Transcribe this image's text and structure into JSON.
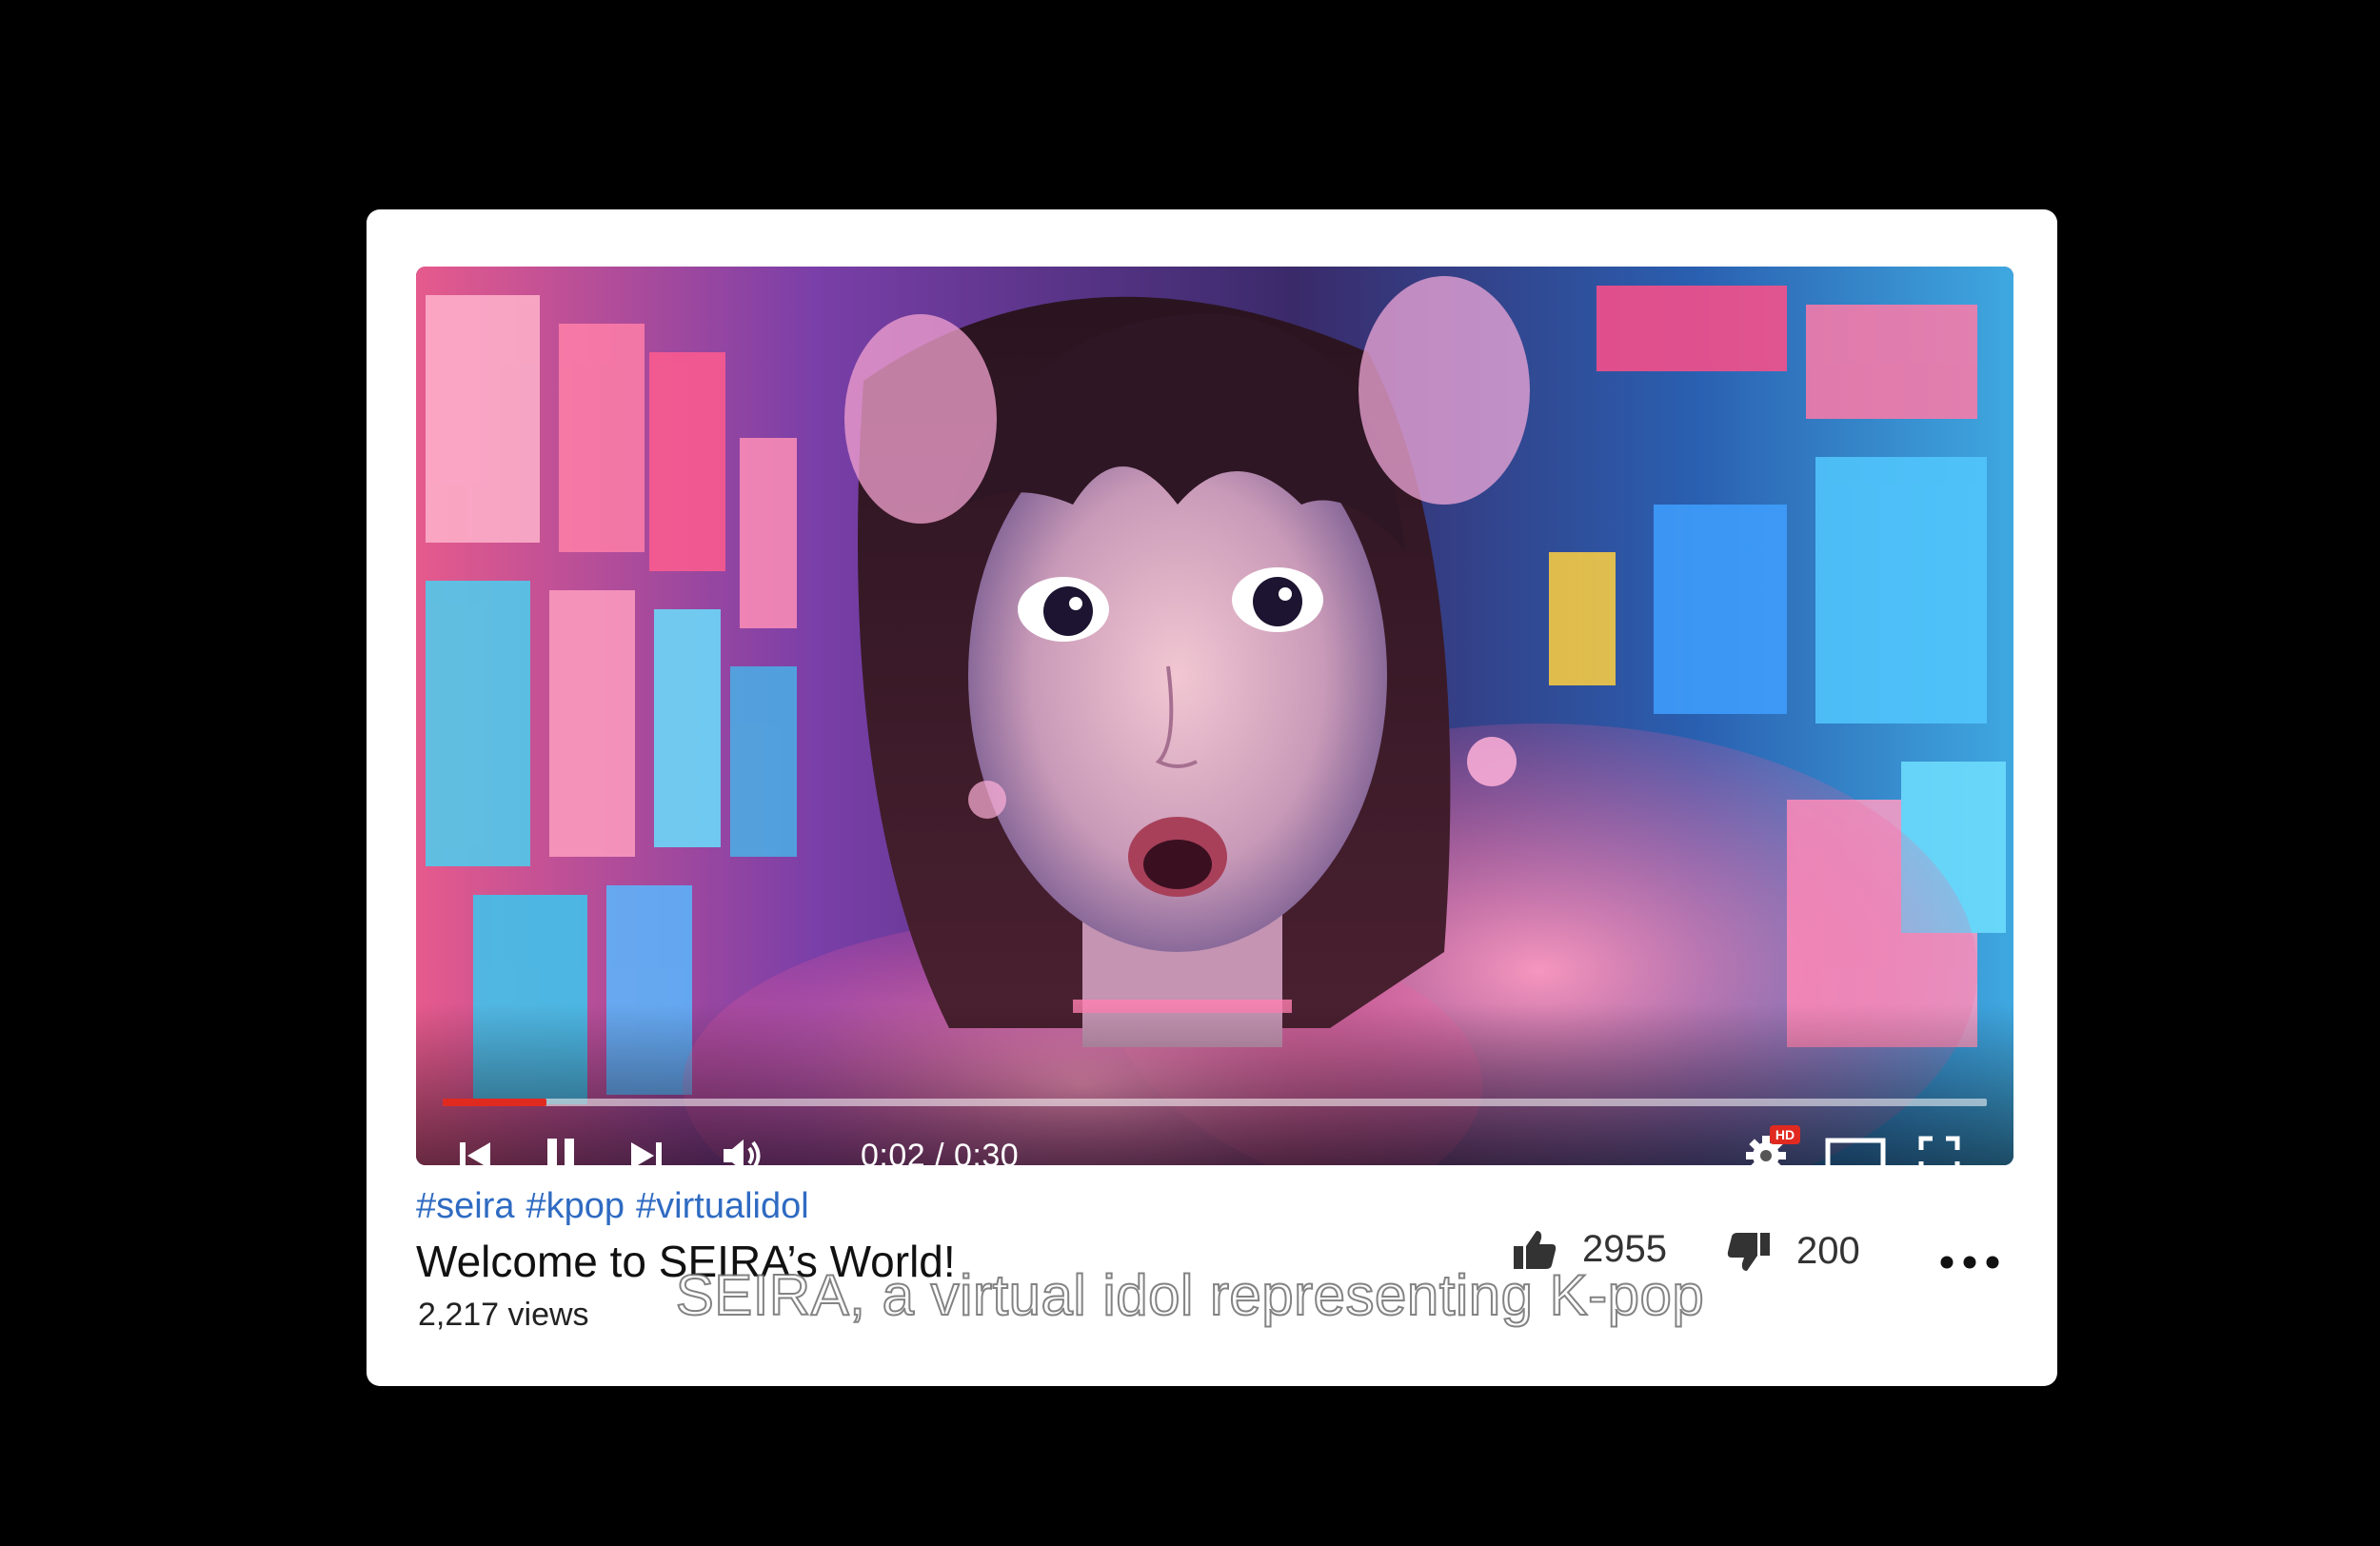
{
  "player": {
    "current_time": "0:02",
    "duration": "0:30",
    "time_display": "0:02 / 0:30",
    "progress_fraction": 0.067,
    "quality_badge": "HD",
    "icons": {
      "previous": "skip-previous-icon",
      "pause": "pause-icon",
      "next": "skip-next-icon",
      "volume": "volume-icon",
      "settings": "gear-icon",
      "theater": "theater-mode-icon",
      "fullscreen": "fullscreen-icon"
    },
    "progress_color": "#e02a20"
  },
  "video": {
    "hashtags": [
      "#seira",
      "#kpop",
      "#virtualidol"
    ],
    "title": "Welcome to SEIRA’s World!",
    "views": "2,217 views",
    "likes": "2955",
    "dislikes": "200",
    "hashtag_color": "#2f6bc2"
  },
  "overlay": {
    "caption": "SEIRA, a virtual idol representing K-pop"
  }
}
